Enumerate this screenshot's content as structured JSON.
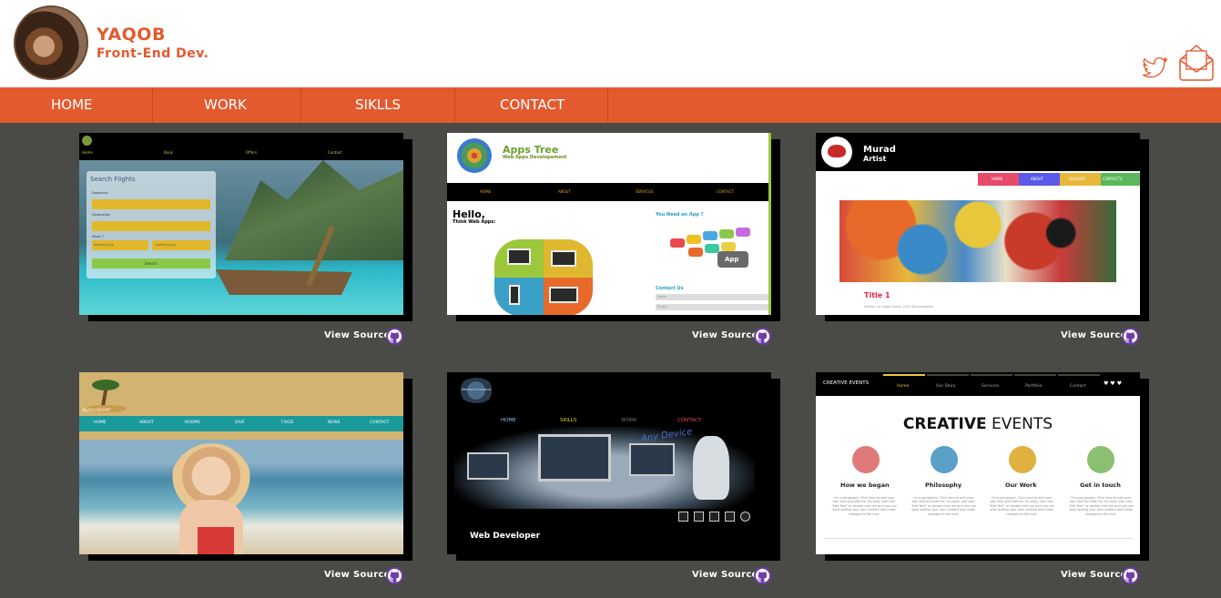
{
  "header": {
    "name": "YAQOB",
    "role": "Front-End Dev.",
    "icons": [
      "twitter-icon",
      "mail-icon",
      "avatar"
    ]
  },
  "nav": {
    "items": [
      {
        "label": "HOME"
      },
      {
        "label": "WORK"
      },
      {
        "label": "SIKLLS"
      },
      {
        "label": "CONTACT"
      }
    ]
  },
  "colors": {
    "accent": "#e35a2e",
    "panel": "#4a4a46",
    "github": "#6e3fa8"
  },
  "projects": {
    "view_label": "View Source",
    "flights": {
      "nav": [
        "Home",
        "Book",
        "Offers",
        "Contact"
      ],
      "form_title": "Search Flights",
      "departure": "Departure",
      "destination": "Destination",
      "when": "When ?",
      "date_placeholder": "dd/mm/yyyy",
      "search": "Search"
    },
    "apps_tree": {
      "title": "Apps Tree",
      "subtitle": "Web Apps Developement",
      "nav": [
        "HOME",
        "ABOUT",
        "SERVICES",
        "CONTACT"
      ],
      "hello": "Hello,",
      "think": "Think Web Apps:",
      "need": "You Need an App ?",
      "contact": "Contact Us",
      "field1": "Name",
      "field2": "Email",
      "app_badge": "App"
    },
    "murad": {
      "name": "Murad",
      "role": "Artist",
      "nav": [
        "HOME",
        "ABOUT",
        "GALLERY",
        "CONTACTS"
      ],
      "post_title": "Title 1",
      "post_meta": "written by Yaqob Sahon 2015 Novahowsten"
    },
    "beach": {
      "logo": "BEACH RESORT",
      "nav": [
        "HOME",
        "ABOUT",
        "ROOMS",
        "DIVE",
        "FOOD",
        "NEWS",
        "CONTACT"
      ]
    },
    "webdev": {
      "logo": "Webfront frontend",
      "nav": [
        "HOME",
        "SKILLS",
        "WORK",
        "CONTACT"
      ],
      "tagline": "Any Device",
      "caption": "Web Developer"
    },
    "events": {
      "brand": "CREATIVE EVENTS",
      "nav": [
        "Home",
        "Our Story",
        "Services",
        "Portfolio",
        "Contact"
      ],
      "heading_bold": "CREATIVE",
      "heading_rest": " EVENTS",
      "features": [
        {
          "title": "How we began",
          "text": "I'm a paragraph. Click here to add your own text and edit me. It's easy. Just click “Edit Text” or double click me and you can start adding your own content and make changes to the font."
        },
        {
          "title": "Philosophy",
          "text": "I'm a paragraph. Click here to add your own text and edit me. It's easy. Just click “Edit Text” or double click me and you can start adding your own content and make changes to the font."
        },
        {
          "title": "Our Work",
          "text": "I'm a paragraph. Click here to add your own text and edit me. It's easy. Just click “Edit Text” or double click me and you can start adding your own content and make changes to the font."
        },
        {
          "title": "Get in touch",
          "text": "I'm a paragraph. Click here to add your own text and edit me. It's easy. Just click “Edit Text” or double click me and you can start adding your own content and make changes to the font."
        }
      ],
      "feature_colors": [
        "#e07a7a",
        "#5aa0c8",
        "#e0b040",
        "#8ac070"
      ]
    }
  }
}
